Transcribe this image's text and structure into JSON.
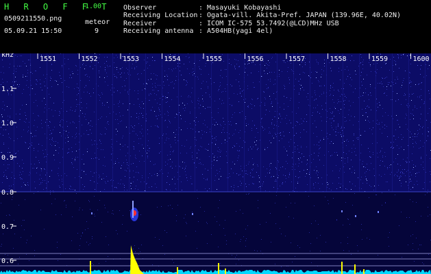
{
  "app": {
    "name": "H R O F F T",
    "version": "1.00"
  },
  "file": {
    "name": "0509211550.png",
    "datetime": "05.09.21 15:50"
  },
  "meteor": {
    "label": "meteor",
    "count": "9"
  },
  "info": [
    {
      "label": "Observer",
      "value": ": Masayuki Kobayashi"
    },
    {
      "label": "Receiving Location",
      "value": ": Ogata-vill. Akita-Pref. JAPAN (139.96E, 40.02N)"
    },
    {
      "label": "Receiver",
      "value": ": ICOM IC-575 53.7492(@LCD)MHz USB"
    },
    {
      "label": "Receiving antenna",
      "value": ": A504HB(yagi 4el)"
    }
  ],
  "yaxis": {
    "unit": "kHz",
    "ticks": [
      "1.1",
      "1.0",
      "0.9",
      "0.8",
      "0.7",
      "0.6"
    ]
  },
  "xaxis": {
    "ticks": [
      "1551",
      "1552",
      "1553",
      "1554",
      "1555",
      "1556",
      "1557",
      "1558",
      "1559",
      "1600"
    ]
  },
  "colors": {
    "background": "#000000",
    "spectrogram": "#0d0d6e",
    "trace": "#00e5ff",
    "peak": "#ffff00",
    "logo": "#44ff44"
  }
}
